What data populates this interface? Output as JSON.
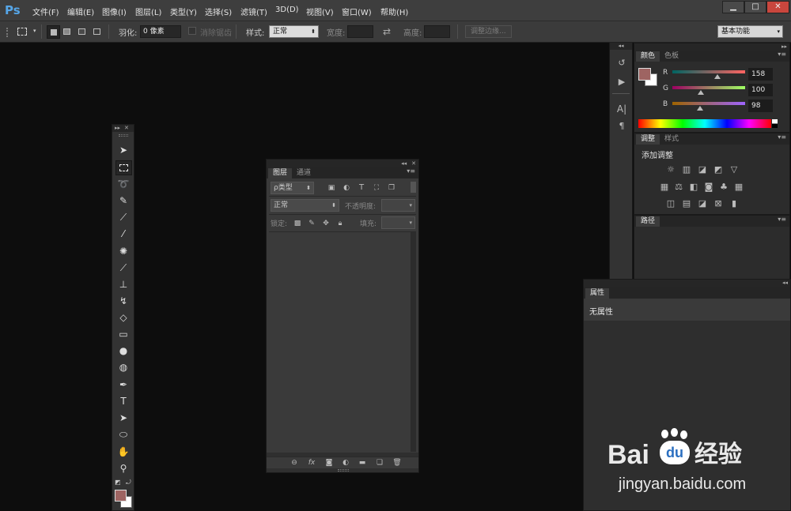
{
  "app": {
    "logo": "Ps"
  },
  "menu": [
    "文件(F)",
    "编辑(E)",
    "图像(I)",
    "图层(L)",
    "类型(Y)",
    "选择(S)",
    "滤镜(T)",
    "3D(D)",
    "视图(V)",
    "窗口(W)",
    "帮助(H)"
  ],
  "window_controls": [
    "▁",
    "□",
    "✕"
  ],
  "options": {
    "feather_label": "羽化:",
    "feather_value": "0 像素",
    "antialias_label": "消除锯齿",
    "style_label": "样式:",
    "style_value": "正常",
    "width_label": "宽度:",
    "height_label": "高度:",
    "refine_edge": "调整边缘...",
    "workspace": "基本功能"
  },
  "color_panel": {
    "tabs": [
      "颜色",
      "色板"
    ],
    "r_label": "R",
    "g_label": "G",
    "b_label": "B",
    "r_value": "158",
    "g_value": "100",
    "b_value": "98",
    "r": 158,
    "g": 100,
    "b": 98,
    "fg_color": "#9e6462"
  },
  "adjust_panel": {
    "tabs": [
      "调整",
      "样式"
    ],
    "title": "添加调整"
  },
  "paths_panel": {
    "tab": "路径"
  },
  "properties_panel": {
    "tab": "属性",
    "empty": "无属性"
  },
  "layers_panel": {
    "tabs": [
      "图层",
      "通道"
    ],
    "filter_type": "ρ类型",
    "blend_mode": "正常",
    "opacity_label": "不透明度:",
    "lock_label": "锁定:",
    "fill_label": "填充:"
  },
  "watermark": {
    "brand": "Bai",
    "brand2": "经验",
    "url": "jingyan.baidu.com"
  }
}
